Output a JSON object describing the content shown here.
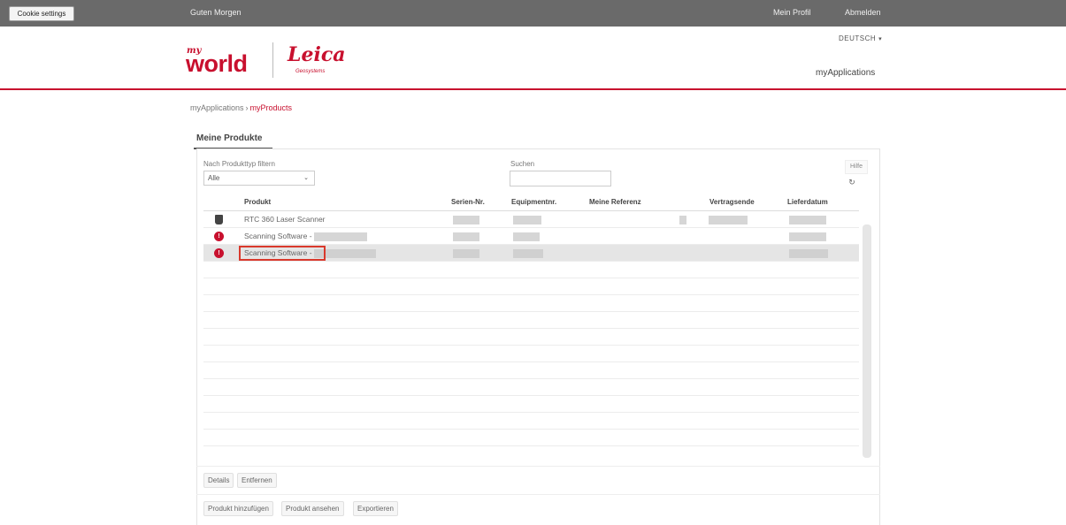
{
  "topbar": {
    "cookie_button": "Cookie settings",
    "greeting": "Guten Morgen",
    "profile_link": "Mein Profil",
    "logout_link": "Abmelden"
  },
  "header": {
    "logo_my": "my",
    "logo_world": "world",
    "logo_leica": "Leica",
    "logo_geosystems": "Geosystems",
    "language": "DEUTSCH",
    "app_title": "myApplications"
  },
  "breadcrumb": {
    "root": "myApplications",
    "separator": "›",
    "current": "myProducts"
  },
  "section": {
    "title": "Meine Produkte"
  },
  "filters": {
    "type_label": "Nach Produkttyp filtern",
    "type_value": "Alle",
    "search_label": "Suchen",
    "search_value": "",
    "help_button": "Hilfe",
    "refresh_icon": "refresh-icon"
  },
  "table": {
    "columns": [
      "Produkt",
      "Serien-Nr.",
      "Equipmentnr.",
      "Meine Referenz",
      "Vertragsende",
      "Lieferdatum"
    ],
    "rows": [
      {
        "icon": "device-icon",
        "product": "RTC 360 Laser Scanner",
        "selected": false
      },
      {
        "icon": "error-icon",
        "product": "Scanning Software -",
        "selected": false
      },
      {
        "icon": "error-icon",
        "product": "Scanning Software -",
        "selected": true
      }
    ]
  },
  "actions": {
    "details": "Details",
    "remove": "Entfernen",
    "add_product": "Produkt hinzufügen",
    "view_product": "Produkt ansehen",
    "export": "Exportieren"
  },
  "colors": {
    "brand_red": "#c8102e",
    "topbar": "#6a6a6a",
    "highlight_box": "#d9392c"
  }
}
